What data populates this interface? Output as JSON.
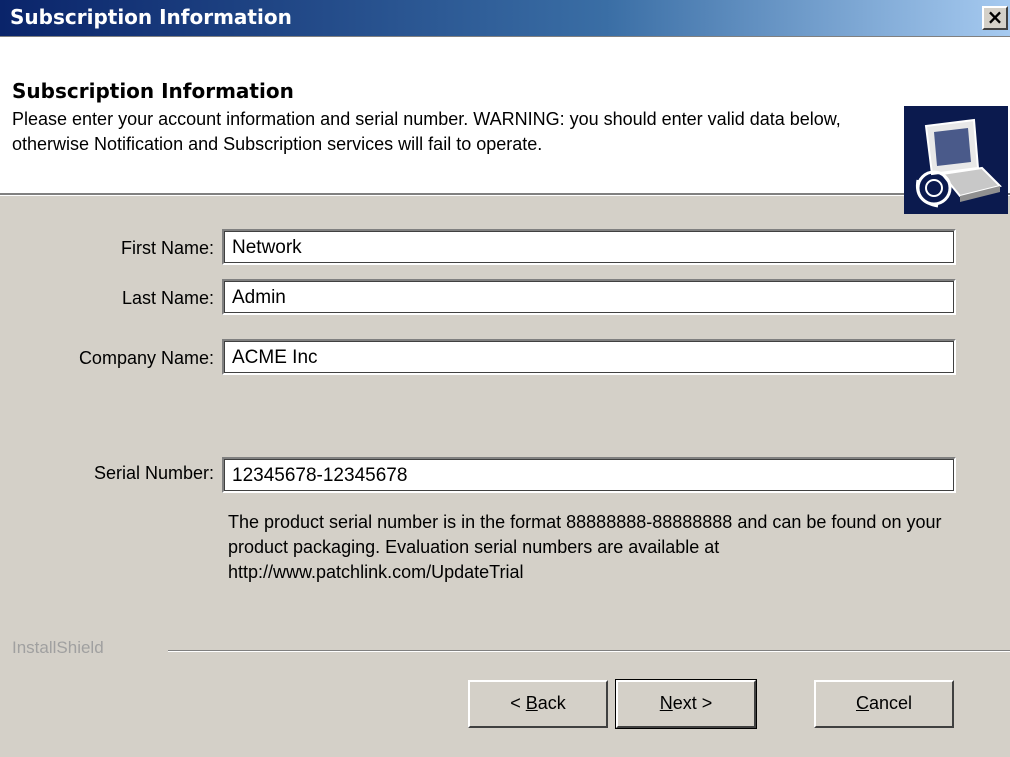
{
  "window": {
    "title": "Subscription Information",
    "close_label": "×"
  },
  "header": {
    "title": "Subscription Information",
    "description": "Please enter your account information and serial number. WARNING: you should enter valid data below, otherwise Notification and Subscription services will fail to operate.",
    "logo_icon": "computer-setup-icon"
  },
  "form": {
    "first_name": {
      "label": "First Name:",
      "value": "Network"
    },
    "last_name": {
      "label": "Last Name:",
      "value": "Admin"
    },
    "company_name": {
      "label": "Company Name:",
      "value": "ACME Inc"
    },
    "serial_number": {
      "label": "Serial Number:",
      "value": "12345678-12345678"
    },
    "serial_help": "The product serial number is in the format 88888888-88888888 and can be found on your product packaging. Evaluation serial numbers are available at http://www.patchlink.com/UpdateTrial"
  },
  "footer": {
    "brand": "InstallShield"
  },
  "buttons": {
    "back": {
      "prefix": "< ",
      "mnemonic": "B",
      "rest": "ack"
    },
    "next": {
      "prefix": "",
      "mnemonic": "N",
      "rest": "ext >"
    },
    "cancel": {
      "prefix": "",
      "mnemonic": "C",
      "rest": "ancel"
    }
  }
}
